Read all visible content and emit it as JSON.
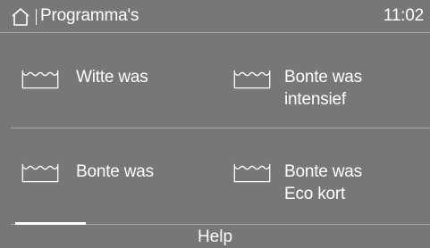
{
  "header": {
    "title": "Programma's",
    "time": "11:02",
    "home_icon": "home-icon"
  },
  "programs": [
    {
      "label": "Witte was",
      "icon": "tub-icon"
    },
    {
      "label": "Bonte was\nintensief",
      "icon": "tub-icon"
    },
    {
      "label": "Bonte was",
      "icon": "tub-icon"
    },
    {
      "label": "Bonte was\nEco kort",
      "icon": "tub-icon"
    }
  ],
  "footer": {
    "help_label": "Help"
  },
  "colors": {
    "background": "#777777",
    "foreground": "#ffffff",
    "divider": "#a9a9a9"
  }
}
